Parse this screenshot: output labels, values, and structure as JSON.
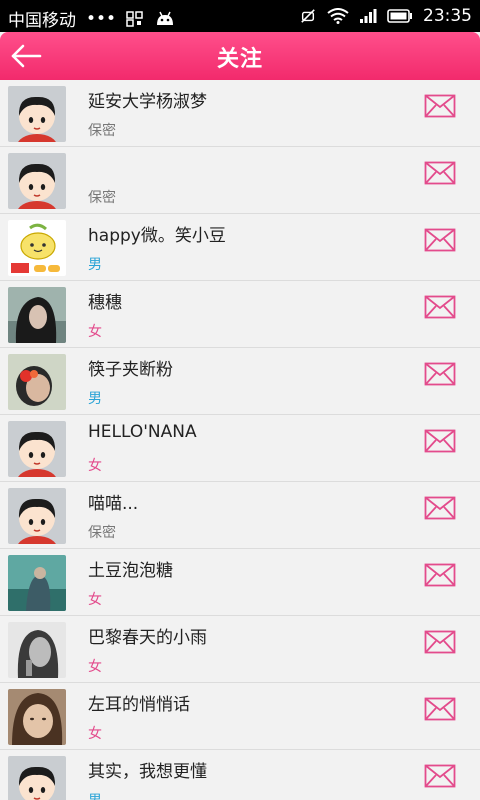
{
  "status_bar": {
    "carrier": "中国移动",
    "dots": "•••",
    "time": "23:35"
  },
  "header": {
    "title": "关注"
  },
  "colors": {
    "accent": "#f22a6c",
    "gender_male": "#2aa3d6",
    "gender_female": "#e34b8c",
    "gender_secret": "#777777"
  },
  "follow_list": [
    {
      "name": "延安大学杨淑梦",
      "gender": "保密",
      "avatar": "cartoon-boy"
    },
    {
      "name": "",
      "gender": "保密",
      "avatar": "cartoon-boy"
    },
    {
      "name": "happy微。笑小豆",
      "gender": "男",
      "avatar": "bean-logo"
    },
    {
      "name": "穗穗",
      "gender": "女",
      "avatar": "photo-girl-dark-hair"
    },
    {
      "name": "筷子夹断粉",
      "gender": "男",
      "avatar": "photo-flower-face"
    },
    {
      "name": "HELLO'NANA",
      "gender": "女",
      "avatar": "cartoon-boy"
    },
    {
      "name": "喵喵...",
      "gender": "保密",
      "avatar": "cartoon-boy"
    },
    {
      "name": "土豆泡泡糖",
      "gender": "女",
      "avatar": "photo-teal-scene"
    },
    {
      "name": "巴黎春天的小雨",
      "gender": "女",
      "avatar": "photo-bw-woman"
    },
    {
      "name": "左耳的悄悄话",
      "gender": "女",
      "avatar": "photo-brown-girl"
    },
    {
      "name": "其实，我想更懂",
      "gender": "男",
      "avatar": "cartoon-boy"
    }
  ]
}
